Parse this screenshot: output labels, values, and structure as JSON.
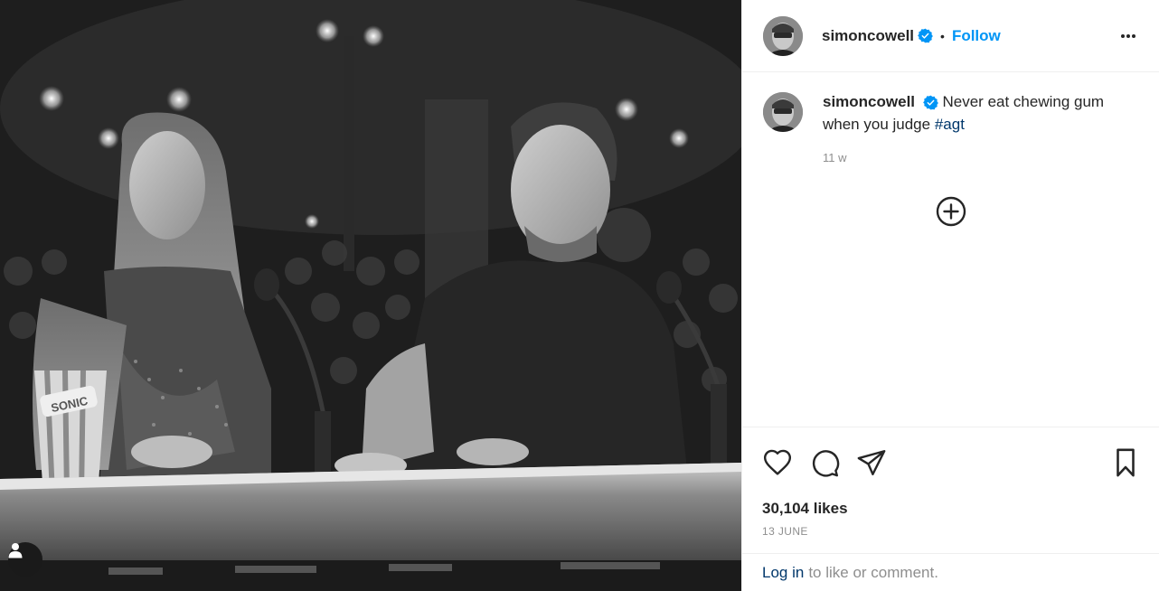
{
  "post": {
    "author": {
      "username": "simoncowell",
      "verified": true,
      "follow_label": "Follow",
      "separator": "•"
    },
    "caption": {
      "username": "simoncowell",
      "text": "Never eat chewing gum when you judge",
      "hashtag": "#agt",
      "time_ago": "11 w"
    },
    "likes": "30,104 likes",
    "date": "13 JUNE",
    "login_prompt": {
      "link": "Log in",
      "text": "to like or comment."
    },
    "photo": {
      "cup_brand": "SONIC"
    },
    "icons": {
      "more": "more-options-icon",
      "like": "heart-icon",
      "comment": "comment-icon",
      "share": "share-icon",
      "save": "bookmark-icon",
      "load_more": "plus-circle-icon",
      "user_tag": "user-tag-icon",
      "verified": "verified-badge-icon"
    },
    "colors": {
      "accent": "#0095f6",
      "verified": "#0095f6",
      "link": "#00376b",
      "muted": "#8e8e8e",
      "text": "#262626"
    }
  }
}
